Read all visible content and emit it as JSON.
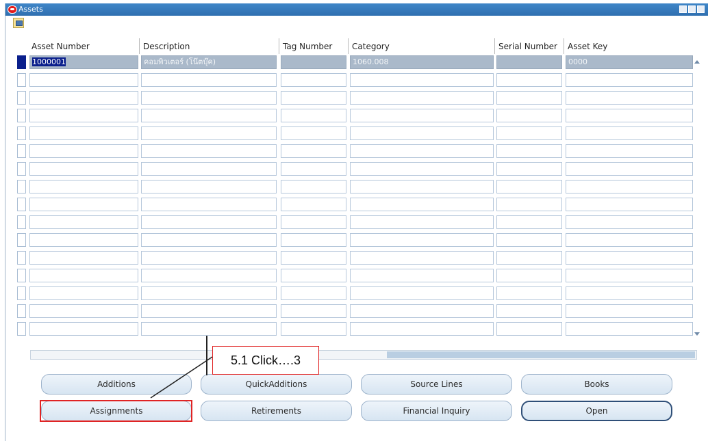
{
  "window": {
    "title": "Assets"
  },
  "toolbar": {
    "icon": "folder-edit-icon"
  },
  "table": {
    "columns": [
      "Asset Number",
      "Description",
      "Tag Number",
      "Category",
      "Serial Number",
      "Asset Key"
    ],
    "rows": [
      [
        "1000001",
        "คอมพิวเตอร์ (โน๊ตบุ๊ค)",
        "",
        "1060.008",
        "",
        "0000"
      ],
      [
        "",
        "",
        "",
        "",
        "",
        ""
      ],
      [
        "",
        "",
        "",
        "",
        "",
        ""
      ],
      [
        "",
        "",
        "",
        "",
        "",
        ""
      ],
      [
        "",
        "",
        "",
        "",
        "",
        ""
      ],
      [
        "",
        "",
        "",
        "",
        "",
        ""
      ],
      [
        "",
        "",
        "",
        "",
        "",
        ""
      ],
      [
        "",
        "",
        "",
        "",
        "",
        ""
      ],
      [
        "",
        "",
        "",
        "",
        "",
        ""
      ],
      [
        "",
        "",
        "",
        "",
        "",
        ""
      ],
      [
        "",
        "",
        "",
        "",
        "",
        ""
      ],
      [
        "",
        "",
        "",
        "",
        "",
        ""
      ],
      [
        "",
        "",
        "",
        "",
        "",
        ""
      ],
      [
        "",
        "",
        "",
        "",
        "",
        ""
      ],
      [
        "",
        "",
        "",
        "",
        "",
        ""
      ],
      [
        "",
        "",
        "",
        "",
        "",
        ""
      ]
    ]
  },
  "buttons": {
    "additions": "Additions",
    "quick_additions": "QuickAdditions",
    "source_lines": "Source Lines",
    "books": "Books",
    "assignments": "Assignments",
    "retirements": "Retirements",
    "financial_inquiry": "Financial Inquiry",
    "open": "Open"
  },
  "annotation": {
    "callout": "5.1 Click….3",
    "highlight_color": "#e02424"
  }
}
